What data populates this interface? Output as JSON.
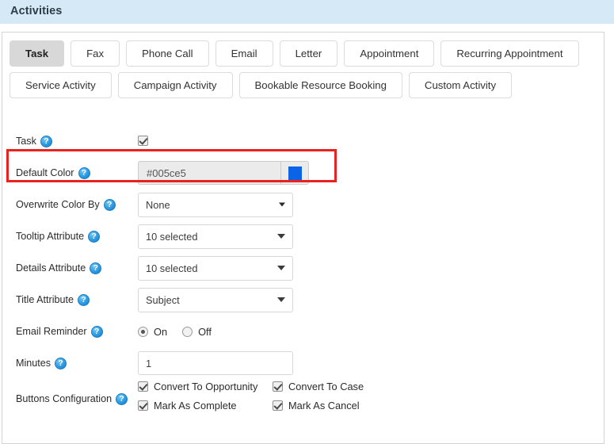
{
  "header": {
    "title": "Activities"
  },
  "tabs": {
    "row1": [
      {
        "label": "Task",
        "active": true
      },
      {
        "label": "Fax",
        "active": false
      },
      {
        "label": "Phone Call",
        "active": false
      },
      {
        "label": "Email",
        "active": false
      },
      {
        "label": "Letter",
        "active": false
      },
      {
        "label": "Appointment",
        "active": false
      },
      {
        "label": "Recurring Appointment",
        "active": false
      }
    ],
    "row2": [
      {
        "label": "Service Activity",
        "active": false
      },
      {
        "label": "Campaign Activity",
        "active": false
      },
      {
        "label": "Bookable Resource Booking",
        "active": false
      },
      {
        "label": "Custom Activity",
        "active": false
      }
    ]
  },
  "form": {
    "task": {
      "label": "Task",
      "checked": true,
      "help": "?"
    },
    "default_color": {
      "label": "Default Color",
      "value": "#005ce5",
      "swatch_color": "#0b63e5",
      "help": "?"
    },
    "overwrite_color_by": {
      "label": "Overwrite Color By",
      "value": "None",
      "help": "?"
    },
    "tooltip_attribute": {
      "label": "Tooltip Attribute",
      "value": "10 selected",
      "help": "?"
    },
    "details_attribute": {
      "label": "Details Attribute",
      "value": "10 selected",
      "help": "?"
    },
    "title_attribute": {
      "label": "Title Attribute",
      "value": "Subject",
      "help": "?"
    },
    "email_reminder": {
      "label": "Email Reminder",
      "on_label": "On",
      "off_label": "Off",
      "selected": "On",
      "help": "?"
    },
    "minutes": {
      "label": "Minutes",
      "value": "1",
      "help": "?"
    },
    "buttons_configuration": {
      "label": "Buttons Configuration",
      "help": "?",
      "items": [
        {
          "label": "Convert To Opportunity",
          "checked": true
        },
        {
          "label": "Convert To Case",
          "checked": true
        },
        {
          "label": "Mark As Complete",
          "checked": true
        },
        {
          "label": "Mark As Cancel",
          "checked": true
        }
      ]
    }
  },
  "highlight": {
    "color": "#e8231f"
  }
}
